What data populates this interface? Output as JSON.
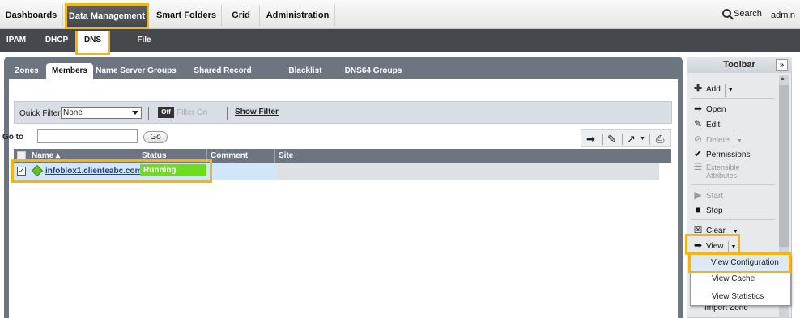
{
  "topnav": {
    "tabs": [
      "Dashboards",
      "Data Management",
      "Smart Folders",
      "Grid",
      "Administration"
    ],
    "search_label": "Search",
    "user": "admin"
  },
  "subnav": {
    "tabs": [
      "IPAM",
      "DHCP",
      "DNS",
      "File Distribution"
    ]
  },
  "inner_tabs": [
    "Zones",
    "Members",
    "Name Server Groups",
    "Shared Record Groups",
    "Blacklist Rulesets",
    "DNS64 Groups"
  ],
  "quick_filter": {
    "label": "Quick Filter",
    "value": "None",
    "toggle": "Off",
    "filter_on": "Filter On",
    "show_filter": "Show Filter"
  },
  "goto": {
    "label": "Go to",
    "button": "Go"
  },
  "grid": {
    "columns": [
      "Name",
      "Status",
      "Comment",
      "Site"
    ],
    "rows": [
      {
        "name": "infoblox1.clienteabc.com",
        "status": "Running",
        "comment": "",
        "site": ""
      }
    ]
  },
  "toolbar": {
    "title": "Toolbar",
    "collapse": "»",
    "items": {
      "add": "Add",
      "open": "Open",
      "edit": "Edit",
      "delete": "Delete",
      "permissions": "Permissions",
      "extensible_1": "Extensible",
      "extensible_2": "Attributes",
      "start": "Start",
      "stop": "Stop",
      "clear": "Clear",
      "view": "View",
      "import_zone": "Import Zone"
    }
  },
  "view_menu": [
    "View Configuration",
    "View Cache",
    "View Statistics"
  ],
  "colors": {
    "highlight": "#f3b512",
    "status_running": "#6ddc1c",
    "nav_dark": "#45494d"
  }
}
